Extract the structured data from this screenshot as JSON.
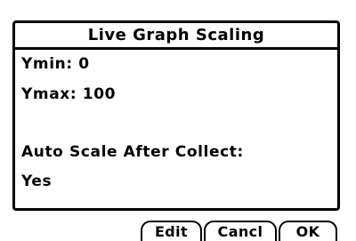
{
  "dialog": {
    "title": "Live Graph Scaling",
    "ymin_label": "Ymin: 0",
    "ymax_label": "Ymax: 100",
    "auto_scale_label": "Auto Scale After Collect:",
    "auto_scale_value": "Yes"
  },
  "buttons": {
    "edit": "Edit",
    "cancel": "Cancl",
    "ok": "OK"
  }
}
